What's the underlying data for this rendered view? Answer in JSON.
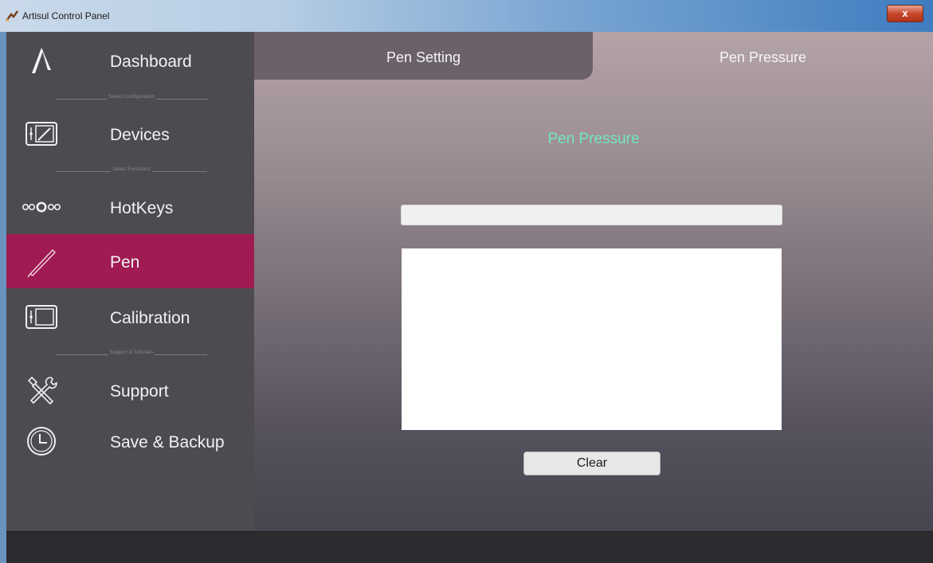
{
  "window": {
    "title": "Artisul Control Panel",
    "close_label": "x"
  },
  "sidebar": {
    "items": [
      {
        "label": "Dashboard",
        "icon": "artisul-logo-icon"
      },
      {
        "label": "Devices",
        "icon": "tablet-device-icon"
      },
      {
        "label": "HotKeys",
        "icon": "hotkeys-dots-icon"
      },
      {
        "label": "Pen",
        "icon": "pen-icon"
      },
      {
        "label": "Calibration",
        "icon": "calibration-screen-icon"
      },
      {
        "label": "Support",
        "icon": "tools-icon"
      },
      {
        "label": "Save & Backup",
        "icon": "clock-icon"
      }
    ],
    "active_item": "Pen",
    "dividers": [
      "Select Configuration",
      "Select Functions",
      "Support & Tutorials"
    ]
  },
  "tabs": {
    "pen_setting": "Pen Setting",
    "pen_pressure": "Pen Pressure"
  },
  "main": {
    "heading": "Pen Pressure",
    "clear_label": "Clear"
  },
  "colors": {
    "accent_active": "#a01a53",
    "heading": "#73e6c3"
  }
}
